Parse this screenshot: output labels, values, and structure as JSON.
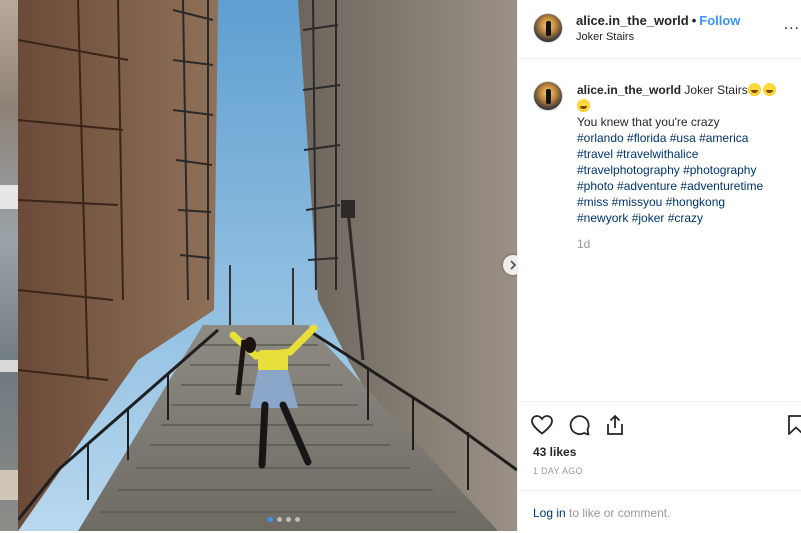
{
  "post": {
    "username": "alice.in_the_world",
    "follow_label": "Follow",
    "separator": "•",
    "location": "Joker Stairs",
    "more_label": "...",
    "caption_title": "Joker Stairs",
    "caption_line": "You knew that you're crazy",
    "hashtag_lines": [
      "#orlando #florida #usa #america",
      "#travel #travelwithalice",
      "#travelphotography #photography",
      "#photo #adventure #adventuretime",
      "#miss #missyou #hongkong",
      "#newyork #joker #crazy"
    ],
    "time_ago": "1d",
    "likes": "43 likes",
    "date": "1 DAY AGO",
    "login_link": "Log in",
    "login_suffix": " to like or comment."
  },
  "carousel": {
    "slide_count": 4,
    "active_index": 0
  },
  "colors": {
    "link_blue": "#3897f0",
    "hashtag": "#003569",
    "muted": "#999999",
    "text": "#262626"
  },
  "icons": [
    "heart-icon",
    "comment-icon",
    "share-icon",
    "bookmark-icon",
    "chevron-right-icon",
    "more-icon",
    "laughing-emoji-icon"
  ]
}
